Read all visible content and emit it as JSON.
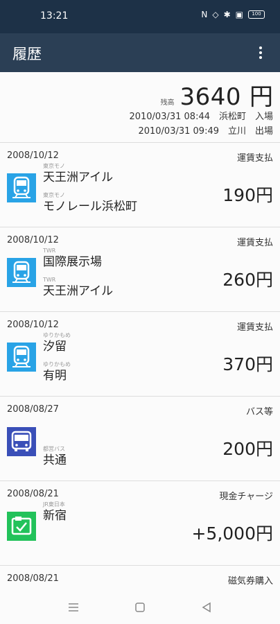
{
  "status": {
    "time": "13:21",
    "battery": "100"
  },
  "app": {
    "title": "履歴"
  },
  "balance": {
    "label": "残高",
    "value": "3640",
    "unit": "円",
    "entry": "2010/03/31 08:44　浜松町　入場",
    "exit": "2010/03/31 09:49　立川　出場"
  },
  "history": [
    {
      "date": "2008/10/12",
      "type": "運賃支払",
      "icon": "train-icon",
      "from_op": "東京モノ",
      "from": "天王洲アイル",
      "to_op": "東京モノ",
      "to": "モノレール浜松町",
      "amount": "190円"
    },
    {
      "date": "2008/10/12",
      "type": "運賃支払",
      "icon": "train-icon",
      "from_op": "TWR",
      "from": "国際展示場",
      "to_op": "TWR",
      "to": "天王洲アイル",
      "amount": "260円"
    },
    {
      "date": "2008/10/12",
      "type": "運賃支払",
      "icon": "train-icon",
      "from_op": "ゆりかもめ",
      "from": "汐留",
      "to_op": "ゆりかもめ",
      "to": "有明",
      "amount": "370円"
    },
    {
      "date": "2008/08/27",
      "type": "バス等",
      "icon": "bus-icon",
      "to_op": "都営バス",
      "to": "共通",
      "amount": "200円"
    },
    {
      "date": "2008/08/21",
      "type": "現金チャージ",
      "icon": "charge-icon",
      "from_op": "JR東日本",
      "from": "新宿",
      "amount": "+5,000円"
    },
    {
      "date": "2008/08/21",
      "type": "磁気券購入"
    }
  ],
  "colors": {
    "train": "#29a3e6",
    "bus": "#3a4fb8",
    "charge": "#22c25a",
    "header": "#2b3f55",
    "status": "#1d3147"
  }
}
